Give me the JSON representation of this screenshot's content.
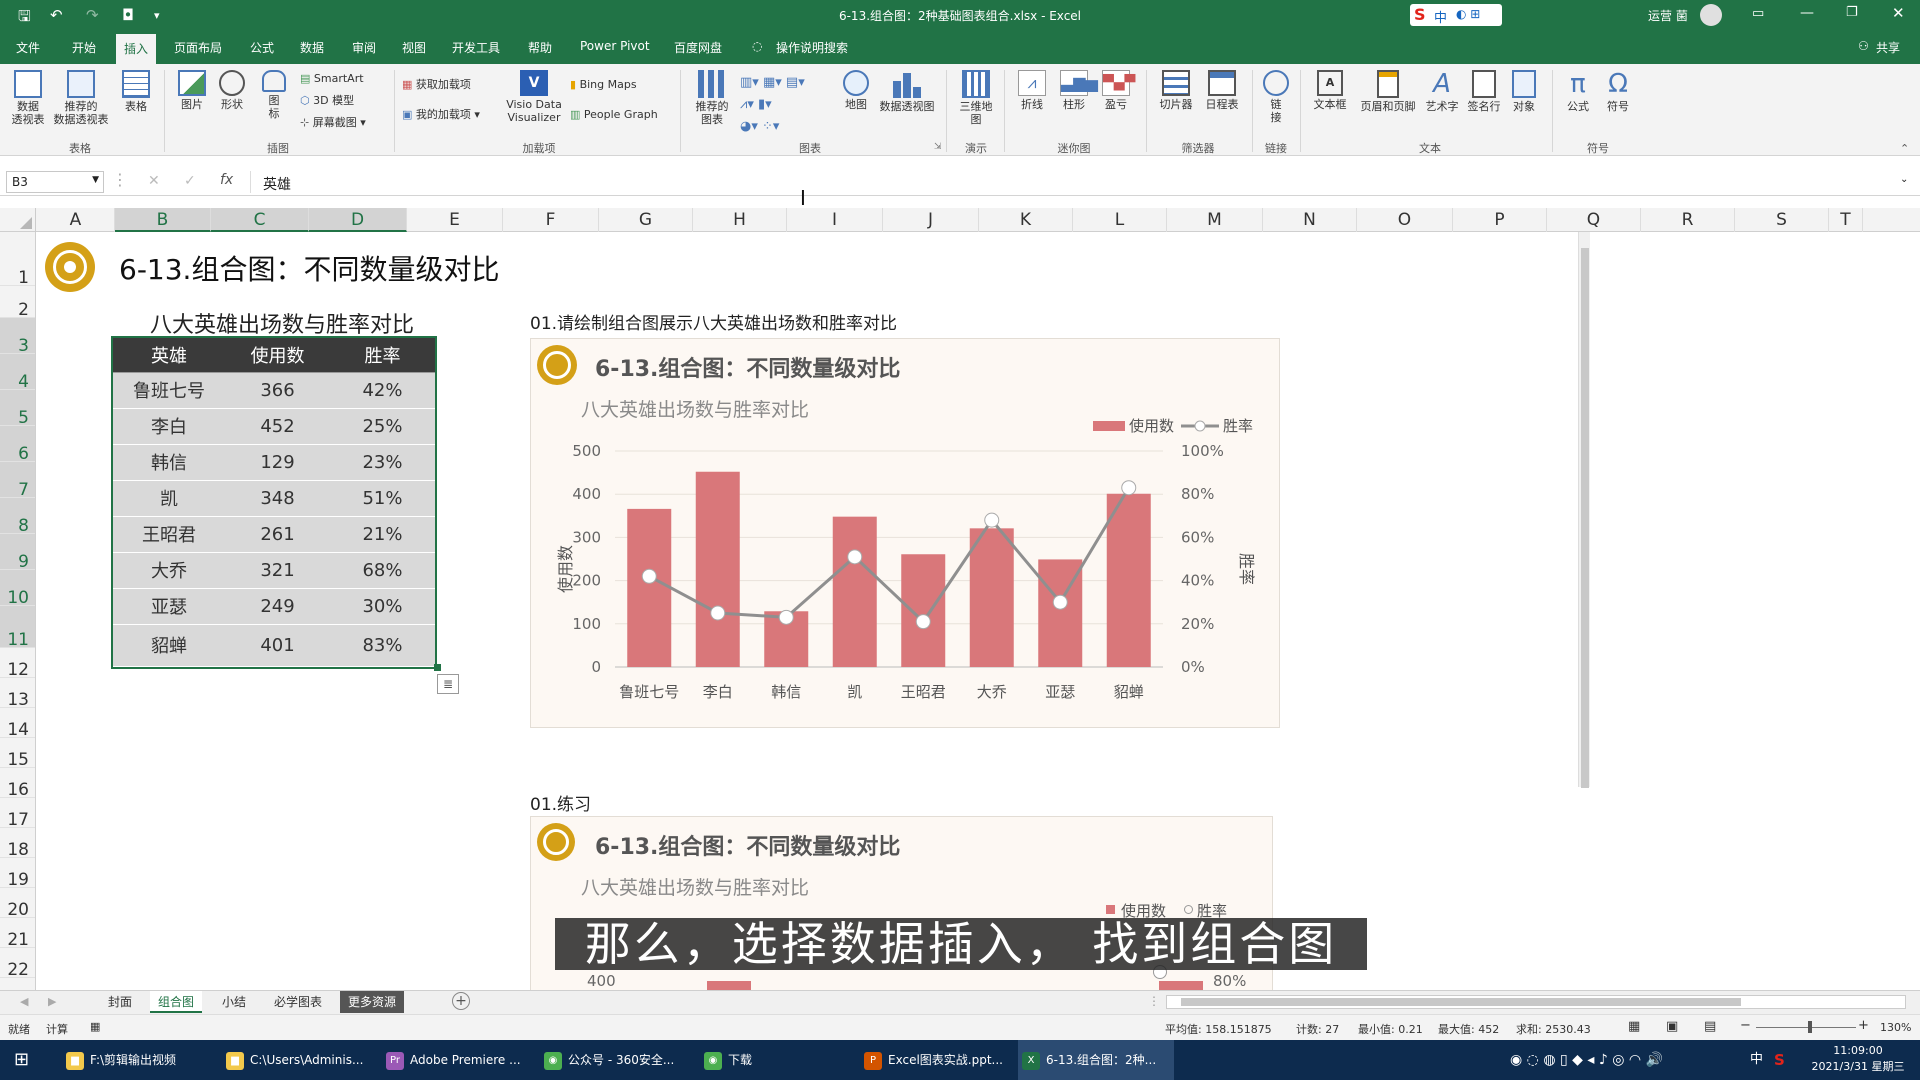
{
  "titlebar": {
    "title": "6-13.组合图：2种基础图表组合.xlsx  -  Excel",
    "user": "运营 菌",
    "ime": "中"
  },
  "menu": {
    "tabs": [
      "文件",
      "开始",
      "插入",
      "页面布局",
      "公式",
      "数据",
      "审阅",
      "视图",
      "开发工具",
      "帮助",
      "Power Pivot",
      "百度网盘"
    ],
    "active": "插入",
    "tell_me": "操作说明搜索",
    "share": "共享"
  },
  "ribbon": {
    "pivot": "数据\n透视表",
    "recommended_pivot": "推荐的\n数据透视表",
    "table": "表格",
    "group_tables": "表格",
    "picture": "图片",
    "shapes": "形状",
    "icons": "图\n标",
    "smartart": "SmartArt",
    "model3d": "3D 模型",
    "screenshot": "屏幕截图",
    "group_illus": "插图",
    "get_addins": "获取加载项",
    "my_addins": "我的加载项",
    "visio": "Visio Data\nVisualizer",
    "bing_maps": "Bing Maps",
    "people_graph": "People Graph",
    "group_addins": "加载项",
    "recommended_charts": "推荐的\n图表",
    "maps": "地图",
    "pivot_chart": "数据透视图",
    "group_charts": "图表",
    "map3d": "三维地\n图",
    "group_tours": "演示",
    "spark_line": "折线",
    "spark_col": "柱形",
    "spark_wl": "盈亏",
    "group_spark": "迷你图",
    "slicer": "切片器",
    "timeline": "日程表",
    "group_filter": "筛选器",
    "link": "链\n接",
    "group_link": "链接",
    "textbox": "文本框",
    "header_footer": "页眉和页脚",
    "wordart": "艺术字",
    "signature": "签名行",
    "object": "对象",
    "group_text": "文本",
    "equation": "公式",
    "symbol": "符号",
    "group_symbols": "符号"
  },
  "formula_bar": {
    "name_box": "B3",
    "fx": "fx",
    "value": "英雄"
  },
  "columns": [
    "A",
    "B",
    "C",
    "D",
    "E",
    "F",
    "G",
    "H",
    "I",
    "J",
    "K",
    "L",
    "M",
    "N",
    "O",
    "P",
    "Q",
    "R",
    "S",
    "T"
  ],
  "rows": [
    "1",
    "2",
    "3",
    "4",
    "5",
    "6",
    "7",
    "8",
    "9",
    "10",
    "11",
    "12",
    "13",
    "14",
    "15",
    "16",
    "17",
    "18",
    "19",
    "20",
    "21",
    "22"
  ],
  "sheet": {
    "title": "6-13.组合图：不同数量级对比",
    "table_title": "八大英雄出场数与胜率对比",
    "table_headers": [
      "英雄",
      "使用数",
      "胜率"
    ],
    "table_rows": [
      [
        "鲁班七号",
        "366",
        "42%"
      ],
      [
        "李白",
        "452",
        "25%"
      ],
      [
        "韩信",
        "129",
        "23%"
      ],
      [
        "凯",
        "348",
        "51%"
      ],
      [
        "王昭君",
        "261",
        "21%"
      ],
      [
        "大乔",
        "321",
        "68%"
      ],
      [
        "亚瑟",
        "249",
        "30%"
      ],
      [
        "貂蝉",
        "401",
        "83%"
      ]
    ],
    "task1": "01.请绘制组合图展示八大英雄出场数和胜率对比",
    "task2": "01.练习"
  },
  "chart1_text": {
    "title": "6-13.组合图：不同数量级对比",
    "subtitle": "八大英雄出场数与胜率对比",
    "legend_bar": "使用数",
    "legend_line": "胜率",
    "ylabel_left": "使用数",
    "ylabel_right": "胜率"
  },
  "chart2_text": {
    "title": "6-13.组合图：不同数量级对比",
    "subtitle": "八大英雄出场数与胜率对比",
    "legend_bar": "使用数",
    "legend_line": "胜率",
    "tick_left": "400",
    "tick_right": "80%"
  },
  "chart_data": {
    "type": "bar",
    "categories": [
      "鲁班七号",
      "李白",
      "韩信",
      "凯",
      "王昭君",
      "大乔",
      "亚瑟",
      "貂蝉"
    ],
    "series": [
      {
        "name": "使用数",
        "type": "bar",
        "axis": "left",
        "values": [
          366,
          452,
          129,
          348,
          261,
          321,
          249,
          401
        ]
      },
      {
        "name": "胜率",
        "type": "line",
        "axis": "right",
        "values": [
          0.42,
          0.25,
          0.23,
          0.51,
          0.21,
          0.68,
          0.3,
          0.83
        ]
      }
    ],
    "title": "6-13.组合图：不同数量级对比",
    "subtitle": "八大英雄出场数与胜率对比",
    "ylabel": "使用数",
    "y2label": "胜率",
    "ylim": [
      0,
      500
    ],
    "y2lim": [
      0,
      1
    ],
    "yticks": [
      "0",
      "100",
      "200",
      "300",
      "400",
      "500"
    ],
    "y2ticks": [
      "0%",
      "20%",
      "40%",
      "60%",
      "80%",
      "100%"
    ],
    "legend": "top-right",
    "bar_color": "#d9777a",
    "line_color": "#8f8f8f"
  },
  "subtitle_caption": "那么，选择数据插入，  找到组合图",
  "sheet_tabs": [
    "封面",
    "组合图",
    "小结",
    "必学图表",
    "更多资源"
  ],
  "active_sheet": "组合图",
  "status": {
    "ready": "就绪",
    "calc": "计算",
    "average": "平均值: 158.151875",
    "count": "计数: 27",
    "min": "最小值: 0.21",
    "max": "最大值: 452",
    "sum": "求和: 2530.43",
    "zoom": "130%"
  },
  "taskbar": {
    "items": [
      "F:\\剪辑输出视频",
      "C:\\Users\\Adminis...",
      "Adobe Premiere ...",
      "公众号 - 360安全...",
      "下载",
      "Excel图表实战.ppt...",
      "6-13.组合图：2种..."
    ],
    "time": "11:09:00",
    "date": "2021/3/31 星期三",
    "ime": "中"
  },
  "colors": {
    "excel_green": "#217346",
    "header_dark": "#3a3a3a",
    "cell_gray": "#d9d9d9",
    "chart_bg": "#fdf8f3",
    "logo_gold": "#d4a017"
  }
}
